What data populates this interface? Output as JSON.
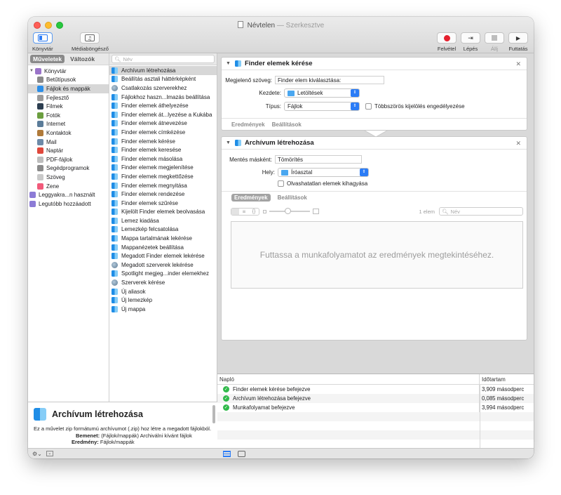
{
  "window": {
    "title": "Névtelen",
    "title_suffix": "— Szerkesztve"
  },
  "toolbar": {
    "library_label": "Könyvtár",
    "media_label": "Médiaböngésző",
    "record_label": "Felvétel",
    "step_label": "Lépés",
    "stop_label": "Állj",
    "run_label": "Futtatás",
    "record_color": "#e5202e"
  },
  "tabs": {
    "actions": "Műveletek",
    "variables": "Változók"
  },
  "search": {
    "placeholder": "Név"
  },
  "library": {
    "root": "Könyvtár",
    "items": [
      {
        "label": "Betűtípusok",
        "icon": "fonts-icon",
        "color": "#8a8a8a"
      },
      {
        "label": "Fájlok és mappák",
        "icon": "finder-icon",
        "color": "#2b8ee8"
      },
      {
        "label": "Fejlesztő",
        "icon": "developer-icon",
        "color": "#9a9a9a"
      },
      {
        "label": "Filmek",
        "icon": "movies-icon",
        "color": "#2c3e50"
      },
      {
        "label": "Fotók",
        "icon": "photos-icon",
        "color": "#6b9e3f"
      },
      {
        "label": "Internet",
        "icon": "internet-icon",
        "color": "#5b7c99"
      },
      {
        "label": "Kontaktok",
        "icon": "contacts-icon",
        "color": "#b07a3a"
      },
      {
        "label": "Mail",
        "icon": "mail-icon",
        "color": "#6d8aa8"
      },
      {
        "label": "Naptár",
        "icon": "calendar-icon",
        "color": "#e0483c"
      },
      {
        "label": "PDF-fájlok",
        "icon": "pdf-icon",
        "color": "#bdbdbd"
      },
      {
        "label": "Segédprogramok",
        "icon": "utilities-icon",
        "color": "#8a8a8a"
      },
      {
        "label": "Szöveg",
        "icon": "text-icon",
        "color": "#c9c9c9"
      },
      {
        "label": "Zene",
        "icon": "music-icon",
        "color": "#f15a7a"
      }
    ],
    "smart": [
      {
        "label": "Leggyakra...n használt",
        "icon": "smart-folder-icon",
        "color": "#8c7bd6"
      },
      {
        "label": "Legutóbb hozzáadott",
        "icon": "smart-folder-icon",
        "color": "#8c7bd6"
      }
    ]
  },
  "actions": [
    {
      "label": "Archívum létrehozása",
      "icon": "finder"
    },
    {
      "label": "Beállítás asztali háttérképként",
      "icon": "finder"
    },
    {
      "label": "Csatlakozás szerverekhez",
      "icon": "globe"
    },
    {
      "label": "Fájlokhoz haszn...lmazás beállítása",
      "icon": "finder"
    },
    {
      "label": "Finder elemek áthelyezése",
      "icon": "finder"
    },
    {
      "label": "Finder elemek át...lyezése a Kukába",
      "icon": "finder"
    },
    {
      "label": "Finder elemek átnevezése",
      "icon": "finder"
    },
    {
      "label": "Finder elemek címkézése",
      "icon": "finder"
    },
    {
      "label": "Finder elemek kérése",
      "icon": "finder"
    },
    {
      "label": "Finder elemek keresése",
      "icon": "finder"
    },
    {
      "label": "Finder elemek másolása",
      "icon": "finder"
    },
    {
      "label": "Finder elemek megjelenítése",
      "icon": "finder"
    },
    {
      "label": "Finder elemek megkettőzése",
      "icon": "finder"
    },
    {
      "label": "Finder elemek megnyitása",
      "icon": "finder"
    },
    {
      "label": "Finder elemek rendezése",
      "icon": "finder"
    },
    {
      "label": "Finder elemek szűrése",
      "icon": "finder"
    },
    {
      "label": "Kijelölt Finder elemek beolvasása",
      "icon": "finder"
    },
    {
      "label": "Lemez kiadása",
      "icon": "finder"
    },
    {
      "label": "Lemezkép felcsatolása",
      "icon": "finder"
    },
    {
      "label": "Mappa tartalmának lekérése",
      "icon": "finder"
    },
    {
      "label": "Mappanézetek beállítása",
      "icon": "finder"
    },
    {
      "label": "Megadott Finder elemek lekérése",
      "icon": "finder"
    },
    {
      "label": "Megadott szerverek lekérése",
      "icon": "globe"
    },
    {
      "label": "Spotlight megjeg...inder elemekhez",
      "icon": "finder"
    },
    {
      "label": "Szerverek kérése",
      "icon": "globe"
    },
    {
      "label": "Új aliasok",
      "icon": "finder"
    },
    {
      "label": "Új lemezkép",
      "icon": "finder"
    },
    {
      "label": "Új mappa",
      "icon": "finder"
    }
  ],
  "description": {
    "title": "Archívum létrehozása",
    "text": "Ez a művelet zip formátumú archívumot (.zip) hoz létre a megadott fájlokból.",
    "input_label": "Bemenet:",
    "input_value": "(Fájlok/mappák) Archiválni kívánt fájlok",
    "output_label": "Eredmény:",
    "output_value": "Fájlok/mappák"
  },
  "card1": {
    "title": "Finder elemek kérése",
    "prompt_label": "Megjelenő szöveg:",
    "prompt_value": "Finder elem kiválasztása:",
    "start_label": "Kezdete:",
    "start_value": "Letöltések",
    "type_label": "Típus:",
    "type_value": "Fájlok",
    "multi_label": "Többszörös kijelölés engedélyezése",
    "tab_results": "Eredmények",
    "tab_options": "Beállítások"
  },
  "card2": {
    "title": "Archívum létrehozása",
    "save_as_label": "Mentés másként:",
    "save_as_value": "Tömörítés",
    "where_label": "Hely:",
    "where_value": "Íróasztal",
    "ignore_label": "Olvashatatlan elemek kihagyása",
    "tab_results": "Eredmények",
    "tab_options": "Beállítások",
    "count_label": "1 elem",
    "results_placeholder": "Futtassa a munkafolyamatot az eredmények megtekintéséhez."
  },
  "log": {
    "col_log": "Napló",
    "col_duration": "Időtartam",
    "rows": [
      {
        "message": "Finder elemek kérése befejezve",
        "duration": "3,909 másodperc"
      },
      {
        "message": "Archívum létrehozása befejezve",
        "duration": "0,085 másodperc"
      },
      {
        "message": "Munkafolyamat befejezve",
        "duration": "3,994 másodperc"
      }
    ]
  }
}
